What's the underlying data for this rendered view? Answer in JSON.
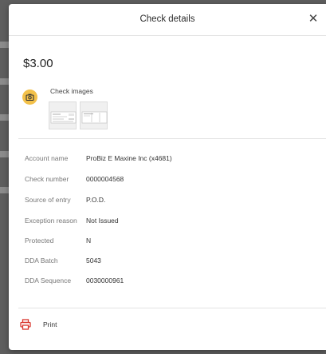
{
  "dialog": {
    "title": "Check details",
    "close_icon": "close-icon",
    "amount": "$3.00",
    "images_label": "Check images",
    "camera_icon": "camera-icon",
    "print_label": "Print",
    "print_icon": "printer-icon"
  },
  "fields": [
    {
      "label": "Account name",
      "value": "ProBiz E Maxine Inc (x4681)"
    },
    {
      "label": "Check number",
      "value": "0000004568"
    },
    {
      "label": "Source of entry",
      "value": "P.O.D."
    },
    {
      "label": "Exception reason",
      "value": "Not Issued"
    },
    {
      "label": "Protected",
      "value": "N"
    },
    {
      "label": "DDA Batch",
      "value": "5043"
    },
    {
      "label": "DDA Sequence",
      "value": "0030000961"
    }
  ],
  "colors": {
    "camera_accent": "#f3c14a",
    "print_icon": "#d9342b"
  }
}
